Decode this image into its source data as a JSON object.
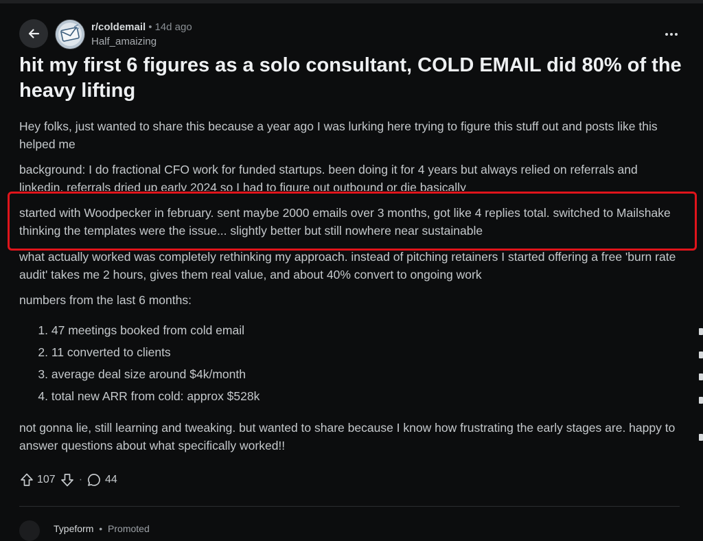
{
  "post": {
    "subreddit": "r/coldemail",
    "separator": "•",
    "age": "14d ago",
    "author": "Half_amaizing",
    "title": "hit my first 6 figures as a solo consultant, COLD EMAIL did 80% of the heavy lifting",
    "paragraphs": [
      "Hey folks, just wanted to share this because a year ago I was lurking here trying to figure this stuff out and posts like this helped me",
      "background: I do fractional CFO work for funded startups. been doing it for 4 years but always relied on referrals and linkedin. referrals dried up early 2024 so I had to figure out outbound or die basically",
      "started with Woodpecker in february. sent maybe 2000 emails over 3 months, got like 4 replies total. switched to Mailshake thinking the templates were the issue... slightly better but still nowhere near sustainable",
      "what actually worked was completely rethinking my approach. instead of pitching retainers I started offering a free 'burn rate audit' takes me 2 hours, gives them real value, and about 40% convert to ongoing work",
      "numbers from the last 6 months:"
    ],
    "list": [
      {
        "num": "1.",
        "text": "47 meetings booked from cold email"
      },
      {
        "num": "2.",
        "text": "11 converted to clients"
      },
      {
        "num": "3.",
        "text": "average deal size around $4k/month"
      },
      {
        "num": "4.",
        "text": "total new ARR from cold: approx $528k"
      }
    ],
    "closing": "not gonna lie, still learning and tweaking. but wanted to share because I know how frustrating the early stages are. happy to answer questions about what specifically worked!!",
    "upvotes": "107",
    "comments": "44",
    "dot": "·"
  },
  "promoted": {
    "name": "Typeform",
    "label": "Promoted"
  },
  "icons": {
    "back": "arrow-left-icon",
    "more": "more-horizontal-icon",
    "upvote": "arrow-up-icon",
    "downvote": "arrow-down-icon",
    "comment": "comment-bubble-icon"
  },
  "colors": {
    "background": "#0c0d0e",
    "highlight": "#e0141b",
    "text": "#c5c9cc"
  }
}
